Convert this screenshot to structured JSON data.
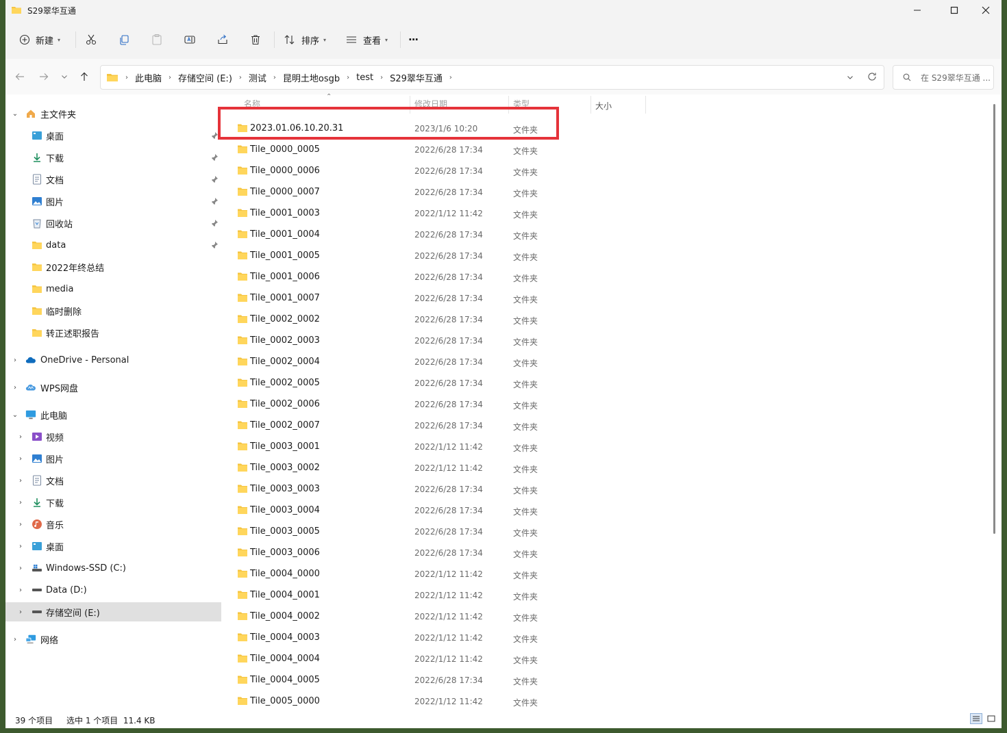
{
  "window": {
    "title": "S29翠华互通"
  },
  "toolbar": {
    "new_label": "新建",
    "sort_label": "排序",
    "view_label": "查看",
    "more_label": "···"
  },
  "address": {
    "crumbs": [
      "此电脑",
      "存储空间 (E:)",
      "测试",
      "昆明土地osgb",
      "test",
      "S29翠华互通"
    ]
  },
  "search": {
    "placeholder": "在 S29翠华互通 ..."
  },
  "sidebar": {
    "quick_access": {
      "label": "主文件夹",
      "items": [
        {
          "label": "桌面",
          "icon": "desktop-icon",
          "pinned": true
        },
        {
          "label": "下载",
          "icon": "download-icon",
          "pinned": true
        },
        {
          "label": "文档",
          "icon": "document-icon",
          "pinned": true
        },
        {
          "label": "图片",
          "icon": "picture-icon",
          "pinned": true
        },
        {
          "label": "回收站",
          "icon": "recycle-bin-icon",
          "pinned": true
        },
        {
          "label": "data",
          "icon": "folder-icon",
          "pinned": true
        },
        {
          "label": "2022年终总结",
          "icon": "folder-icon",
          "pinned": false
        },
        {
          "label": "media",
          "icon": "folder-icon",
          "pinned": false
        },
        {
          "label": "临时删除",
          "icon": "folder-icon",
          "pinned": false
        },
        {
          "label": "转正述职报告",
          "icon": "folder-icon",
          "pinned": false
        }
      ]
    },
    "onedrive": "OneDrive - Personal",
    "wps": "WPS网盘",
    "this_pc": {
      "label": "此电脑",
      "items": [
        {
          "label": "视频",
          "icon": "video-icon"
        },
        {
          "label": "图片",
          "icon": "picture-icon"
        },
        {
          "label": "文档",
          "icon": "document-icon"
        },
        {
          "label": "下载",
          "icon": "download-icon"
        },
        {
          "label": "音乐",
          "icon": "music-icon"
        },
        {
          "label": "桌面",
          "icon": "desktop-icon"
        },
        {
          "label": "Windows-SSD (C:)",
          "icon": "drive-icon"
        },
        {
          "label": "Data (D:)",
          "icon": "drive-icon"
        },
        {
          "label": "存储空间 (E:)",
          "icon": "drive-icon",
          "selected": true
        }
      ]
    },
    "network": "网络"
  },
  "columns": {
    "name": "名称",
    "date": "修改日期",
    "type": "类型",
    "size": "大小"
  },
  "files": [
    {
      "name": "2023.01.06.10.20.31",
      "date": "2023/1/6 10:20",
      "type": "文件夹"
    },
    {
      "name": "Tile_0000_0005",
      "date": "2022/6/28 17:34",
      "type": "文件夹"
    },
    {
      "name": "Tile_0000_0006",
      "date": "2022/6/28 17:34",
      "type": "文件夹"
    },
    {
      "name": "Tile_0000_0007",
      "date": "2022/6/28 17:34",
      "type": "文件夹"
    },
    {
      "name": "Tile_0001_0003",
      "date": "2022/1/12 11:42",
      "type": "文件夹"
    },
    {
      "name": "Tile_0001_0004",
      "date": "2022/6/28 17:34",
      "type": "文件夹"
    },
    {
      "name": "Tile_0001_0005",
      "date": "2022/6/28 17:34",
      "type": "文件夹"
    },
    {
      "name": "Tile_0001_0006",
      "date": "2022/6/28 17:34",
      "type": "文件夹"
    },
    {
      "name": "Tile_0001_0007",
      "date": "2022/6/28 17:34",
      "type": "文件夹"
    },
    {
      "name": "Tile_0002_0002",
      "date": "2022/6/28 17:34",
      "type": "文件夹"
    },
    {
      "name": "Tile_0002_0003",
      "date": "2022/6/28 17:34",
      "type": "文件夹"
    },
    {
      "name": "Tile_0002_0004",
      "date": "2022/6/28 17:34",
      "type": "文件夹"
    },
    {
      "name": "Tile_0002_0005",
      "date": "2022/6/28 17:34",
      "type": "文件夹"
    },
    {
      "name": "Tile_0002_0006",
      "date": "2022/6/28 17:34",
      "type": "文件夹"
    },
    {
      "name": "Tile_0002_0007",
      "date": "2022/6/28 17:34",
      "type": "文件夹"
    },
    {
      "name": "Tile_0003_0001",
      "date": "2022/1/12 11:42",
      "type": "文件夹"
    },
    {
      "name": "Tile_0003_0002",
      "date": "2022/1/12 11:42",
      "type": "文件夹"
    },
    {
      "name": "Tile_0003_0003",
      "date": "2022/6/28 17:34",
      "type": "文件夹"
    },
    {
      "name": "Tile_0003_0004",
      "date": "2022/6/28 17:34",
      "type": "文件夹"
    },
    {
      "name": "Tile_0003_0005",
      "date": "2022/6/28 17:34",
      "type": "文件夹"
    },
    {
      "name": "Tile_0003_0006",
      "date": "2022/6/28 17:34",
      "type": "文件夹"
    },
    {
      "name": "Tile_0004_0000",
      "date": "2022/1/12 11:42",
      "type": "文件夹"
    },
    {
      "name": "Tile_0004_0001",
      "date": "2022/1/12 11:42",
      "type": "文件夹"
    },
    {
      "name": "Tile_0004_0002",
      "date": "2022/1/12 11:42",
      "type": "文件夹"
    },
    {
      "name": "Tile_0004_0003",
      "date": "2022/1/12 11:42",
      "type": "文件夹"
    },
    {
      "name": "Tile_0004_0004",
      "date": "2022/1/12 11:42",
      "type": "文件夹"
    },
    {
      "name": "Tile_0004_0005",
      "date": "2022/6/28 17:34",
      "type": "文件夹"
    },
    {
      "name": "Tile_0005_0000",
      "date": "2022/1/12 11:42",
      "type": "文件夹"
    }
  ],
  "status": {
    "item_count": "39 个项目",
    "selection": "选中 1 个项目  11.4 KB"
  },
  "colors": {
    "folder": "#f5c542",
    "highlight": "#e5333a",
    "selected_bg": "#e0e0e0"
  }
}
